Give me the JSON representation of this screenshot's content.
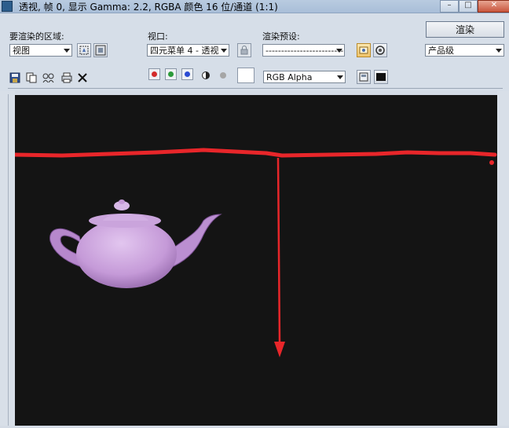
{
  "window": {
    "title": "透视, 帧 0, 显示 Gamma: 2.2, RGBA 颜色 16 位/通道 (1:1)",
    "minimize_glyph": "–",
    "maximize_glyph": "□",
    "close_glyph": "✕"
  },
  "area": {
    "label": "要渲染的区域:",
    "value": "视图"
  },
  "viewport_select": {
    "label": "视口:",
    "value": "四元菜单 4 - 透视"
  },
  "preset": {
    "label": "渲染预设:",
    "value": "-------------------------"
  },
  "render_button": {
    "label": "渲染"
  },
  "quality": {
    "value": "产品级"
  },
  "channel": {
    "value": "RGB Alpha"
  },
  "colors": {
    "red": "#d32b2b",
    "green": "#2b9a3a",
    "blue": "#2b4bd3",
    "viewport_bg": "#141414",
    "annotation": "#e8262a",
    "teapot": "#c59ad8"
  },
  "icons": [
    "save-icon",
    "copy-icon",
    "clone-icon",
    "print-icon",
    "clear-icon",
    "red-channel-icon",
    "green-channel-icon",
    "blue-channel-icon",
    "monochrome-icon",
    "alpha-icon",
    "color-swatch-icon",
    "lock-icon",
    "camera-icon",
    "environment-icon",
    "area-region-icon",
    "area-crop-icon",
    "toggle-ui-icon",
    "display-mode-icon"
  ]
}
